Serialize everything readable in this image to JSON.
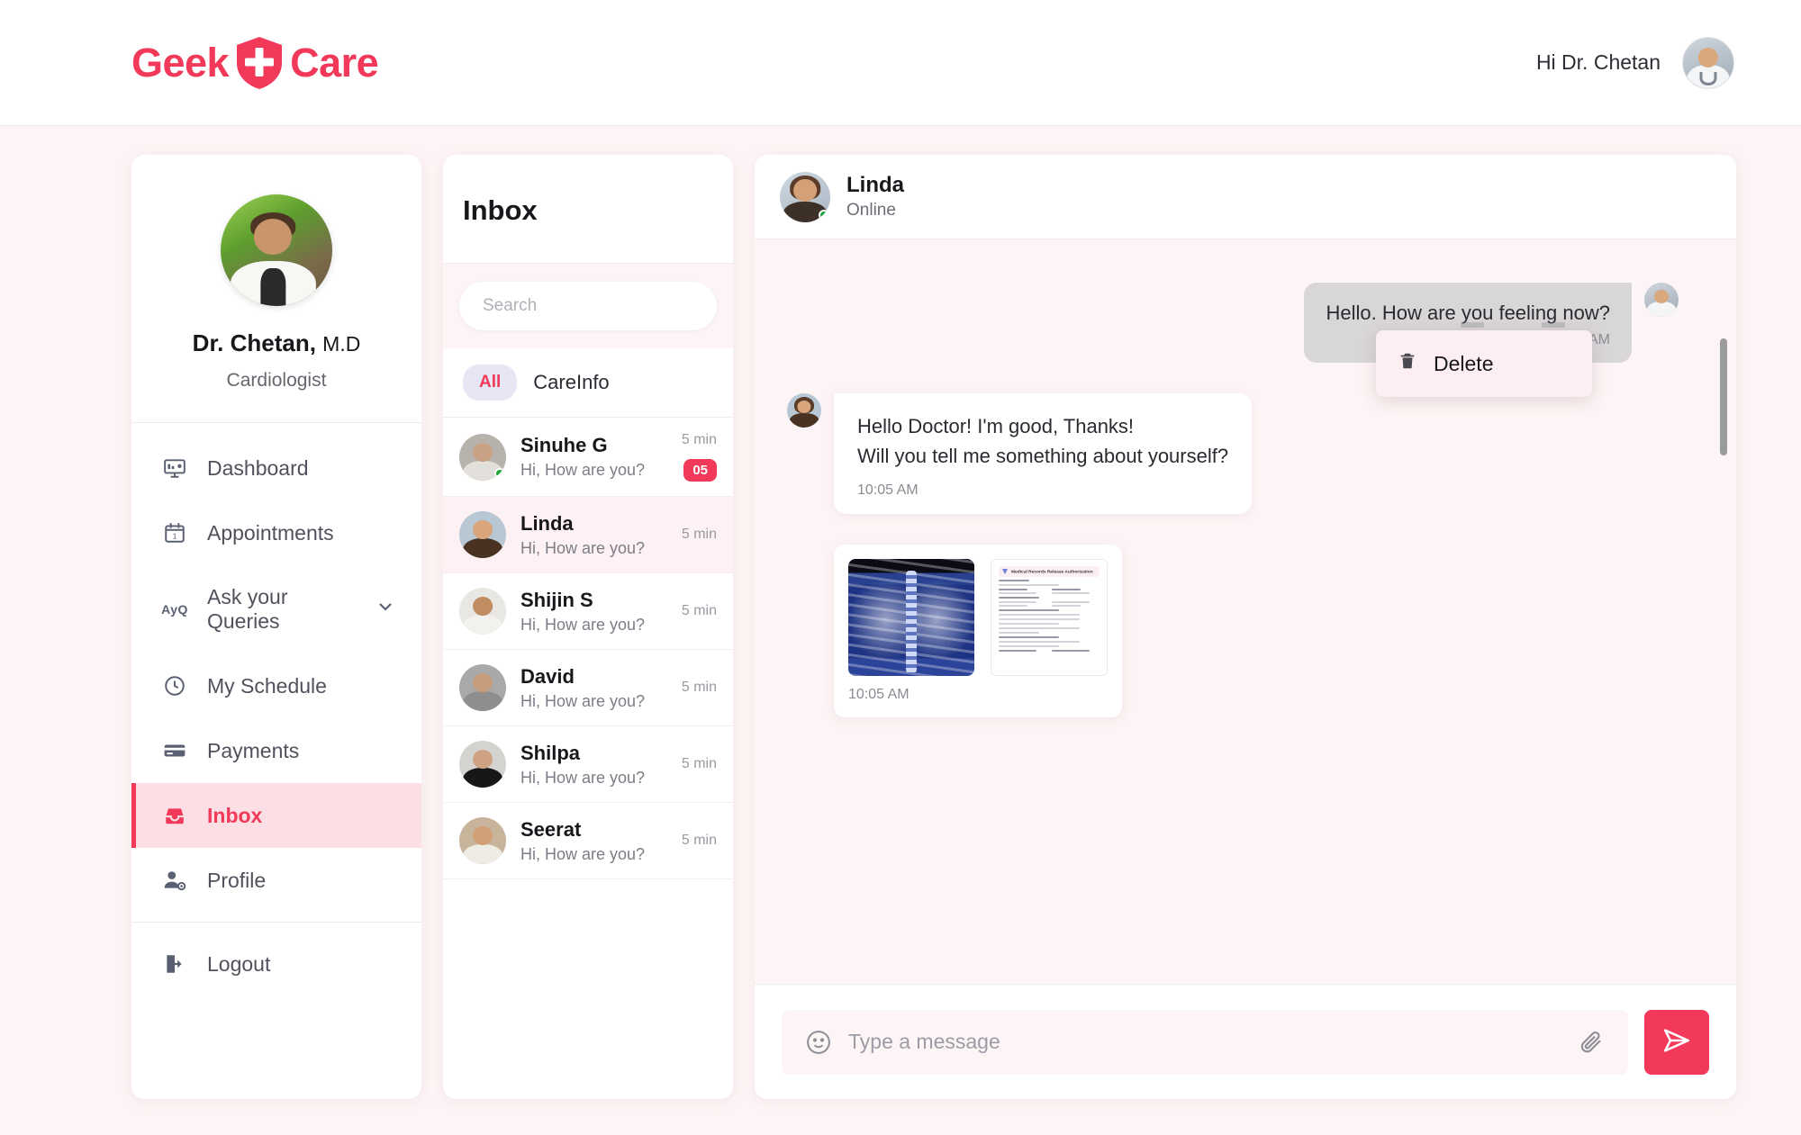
{
  "brand": {
    "name_left": "Geek",
    "name_right": "Care",
    "color": "#f2395a",
    "shield_icon": "shield-plus-icon"
  },
  "header": {
    "greeting": "Hi Dr. Chetan",
    "avatar": "doctor-avatar"
  },
  "sidebar": {
    "doctor": {
      "name_bold": "Dr. Chetan,",
      "name_suffix": "M.D",
      "role": "Cardiologist",
      "photo": "doctor-profile-photo"
    },
    "items": [
      {
        "label": "Dashboard",
        "icon": "dashboard-icon",
        "active": false,
        "expandable": false
      },
      {
        "label": "Appointments",
        "icon": "calendar-icon",
        "active": false,
        "expandable": false
      },
      {
        "label": "Ask your Queries",
        "icon": "ayq-icon",
        "icon_text": "AyQ",
        "active": false,
        "expandable": true,
        "chevron": "chevron-down-icon"
      },
      {
        "label": "My Schedule",
        "icon": "clock-icon",
        "active": false,
        "expandable": false
      },
      {
        "label": "Payments",
        "icon": "credit-card-icon",
        "active": false,
        "expandable": false
      },
      {
        "label": "Inbox",
        "icon": "inbox-icon",
        "active": true,
        "expandable": false
      },
      {
        "label": "Profile",
        "icon": "user-settings-icon",
        "active": false,
        "expandable": false
      }
    ],
    "logout": {
      "label": "Logout",
      "icon": "logout-icon"
    }
  },
  "inbox": {
    "title": "Inbox",
    "search": {
      "placeholder": "Search",
      "value": ""
    },
    "filters": {
      "chip": "All",
      "tab": "CareInfo"
    },
    "conversations": [
      {
        "name": "Sinuhe G",
        "preview": "Hi, How are you?",
        "time": "5 min",
        "unread": "05",
        "online": true,
        "selected": false,
        "avatar_colors": [
          "#c9a184",
          "#b8b2ad",
          "#2e2c2b"
        ]
      },
      {
        "name": "Linda",
        "preview": "Hi, How are you?",
        "time": "5 min",
        "unread": "",
        "online": false,
        "selected": true,
        "avatar_colors": [
          "#d8a57c",
          "#b7c7d4",
          "#4a3222"
        ]
      },
      {
        "name": "Shijin S",
        "preview": "Hi, How are you?",
        "time": "5 min",
        "unread": "",
        "online": false,
        "selected": false,
        "avatar_colors": [
          "#c08c62",
          "#e9e7e2",
          "#1c1b1a"
        ]
      },
      {
        "name": "David",
        "preview": "Hi, How are you?",
        "time": "5 min",
        "unread": "",
        "online": false,
        "selected": false,
        "avatar_colors": [
          "#c59c7c",
          "#a9a9a9",
          "#2a2a2a"
        ]
      },
      {
        "name": "Shilpa",
        "preview": "Hi, How are you?",
        "time": "5 min",
        "unread": "",
        "online": false,
        "selected": false,
        "avatar_colors": [
          "#cfa284",
          "#d5d3d0",
          "#171717"
        ]
      },
      {
        "name": "Seerat",
        "preview": "Hi, How are you?",
        "time": "5 min",
        "unread": "",
        "online": false,
        "selected": false,
        "avatar_colors": [
          "#d2a078",
          "#c7b49a",
          "#6e4a2c"
        ]
      }
    ]
  },
  "chat": {
    "contact": {
      "name": "Linda",
      "status": "Online",
      "online": true
    },
    "dropdown": {
      "delete_label": "Delete",
      "icon": "trash-icon"
    },
    "messages": [
      {
        "direction": "out",
        "text": "Hello. How are you feeling now?",
        "time": "10:00 AM",
        "type": "text"
      },
      {
        "direction": "in",
        "line1": "Hello Doctor! I'm good, Thanks!",
        "line2": "Will you tell me something about yourself?",
        "time": "10:05 AM",
        "type": "text"
      },
      {
        "direction": "in",
        "time": "10:05 AM",
        "type": "attachment",
        "attachments": [
          "chest-xray-image",
          "medical-records-release-authorization-document"
        ],
        "doc_title": "Medical Records Release Authorization"
      }
    ],
    "composer": {
      "placeholder": "Type a message",
      "value": "",
      "emoji_icon": "smiley-icon",
      "attach_icon": "paperclip-icon",
      "send_icon": "send-icon"
    }
  },
  "colors": {
    "accent": "#f2395a",
    "bg": "#fdf4f5",
    "panel": "#ffffff",
    "online": "#1ea836"
  }
}
